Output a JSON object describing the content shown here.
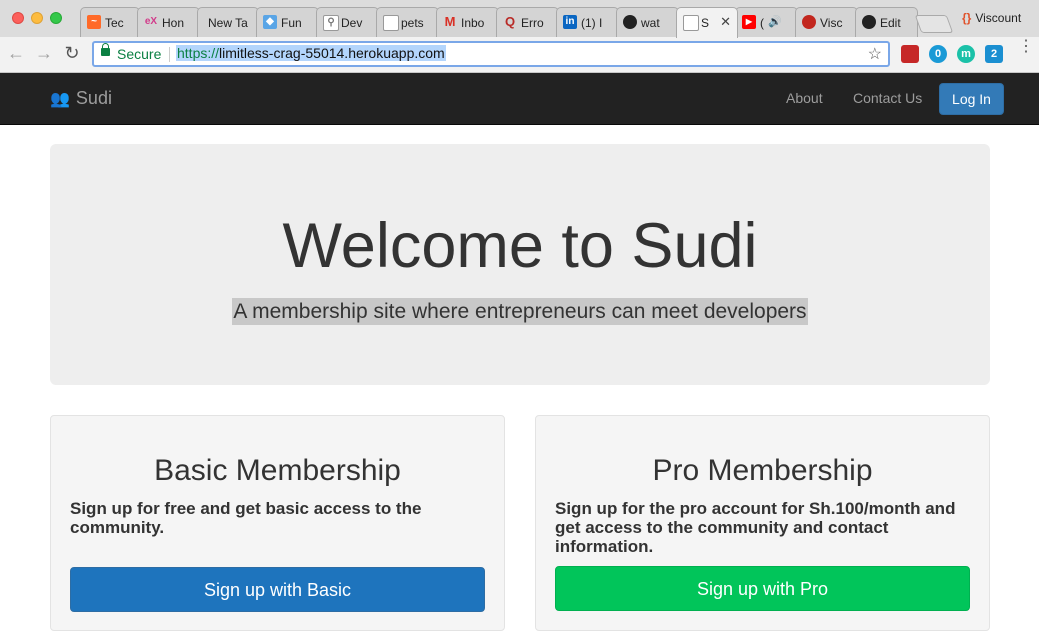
{
  "browser": {
    "tabs": [
      {
        "label": "Tec",
        "favicon": "trending-icon",
        "color": "#ff6a28"
      },
      {
        "label": "Hon",
        "favicon": "edx-icon",
        "color": "#d23b8a"
      },
      {
        "label": "New Ta",
        "favicon": "",
        "color": ""
      },
      {
        "label": "Fun",
        "favicon": "fish-icon",
        "color": "#5aa5e6"
      },
      {
        "label": "Dev",
        "favicon": "search-page-icon",
        "color": "#777777"
      },
      {
        "label": "pets",
        "favicon": "page-icon",
        "color": "#888888"
      },
      {
        "label": "Inbo",
        "favicon": "gmail-icon",
        "color": "#d93025"
      },
      {
        "label": "Erro",
        "favicon": "quora-icon",
        "color": "#b92b27"
      },
      {
        "label": "(1) I",
        "favicon": "linkedin-icon",
        "color": "#0a66c2"
      },
      {
        "label": "wat",
        "favicon": "github-icon",
        "color": "#222222"
      },
      {
        "label": "S",
        "favicon": "page-icon",
        "color": "#888888"
      },
      {
        "label": "(",
        "favicon": "youtube-icon",
        "color": "#ff0000"
      },
      {
        "label": "Visc",
        "favicon": "viscount-icon",
        "color": "#c2271e"
      },
      {
        "label": "Edit",
        "favicon": "github-icon",
        "color": "#222222"
      }
    ],
    "profile_name": "Viscount",
    "address": {
      "secure_label": "Secure",
      "scheme": "https://",
      "host": "limitless-crag-55014.herokuapp.com"
    },
    "extensions": [
      {
        "name": "ext-red-icon",
        "badge": ""
      },
      {
        "name": "ext-blue-icon",
        "badge": "0"
      },
      {
        "name": "ext-teal-icon",
        "badge": "m"
      },
      {
        "name": "ext-skype-icon",
        "badge": "2"
      }
    ]
  },
  "navbar": {
    "brand": "Sudi",
    "links": [
      "About",
      "Contact Us"
    ],
    "login": "Log In"
  },
  "hero": {
    "title": "Welcome to Sudi",
    "subtitle": "A membership site where entrepreneurs can meet developers"
  },
  "plans": [
    {
      "title": "Basic Membership",
      "description": "Sign up for free and get basic access to the community.",
      "button": "Sign up with Basic",
      "button_color": "#1e74bd"
    },
    {
      "title": "Pro Membership",
      "description": "Sign up for the pro account for Sh.100/month and get access to the community and contact information.",
      "button": "Sign up with Pro",
      "button_color": "#01c55a"
    }
  ]
}
